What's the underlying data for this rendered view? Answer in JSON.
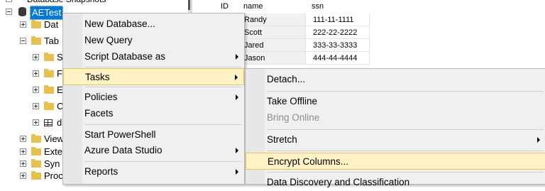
{
  "tree": {
    "top_partial_label": "Database Snapshots",
    "selected_db": "AETest",
    "rows": [
      {
        "label": "Dat"
      },
      {
        "label": "Tab"
      },
      {
        "label": "S"
      },
      {
        "label": "F"
      },
      {
        "label": "E"
      },
      {
        "label": "C"
      },
      {
        "label": "d"
      },
      {
        "label": "View"
      },
      {
        "label": "Exte"
      },
      {
        "label": "Syn"
      },
      {
        "label": "Proc"
      }
    ]
  },
  "grid": {
    "headers": [
      "ID",
      "name",
      "ssn"
    ],
    "rows": [
      [
        "",
        "Randy",
        "111-11-1111"
      ],
      [
        "",
        "Scott",
        "222-22-2222"
      ],
      [
        "",
        "Jared",
        "333-33-3333"
      ],
      [
        "",
        "Jason",
        "444-44-4444"
      ]
    ]
  },
  "context_menu": {
    "items": [
      {
        "label": "New Database..."
      },
      {
        "label": "New Query"
      },
      {
        "label": "Script Database as"
      },
      {
        "label": "Tasks"
      },
      {
        "label": "Policies"
      },
      {
        "label": "Facets"
      },
      {
        "label": "Start PowerShell"
      },
      {
        "label": "Azure Data Studio"
      },
      {
        "label": "Reports"
      }
    ]
  },
  "tasks_submenu": {
    "items": [
      {
        "label": "Detach..."
      },
      {
        "label": "Take Offline"
      },
      {
        "label": "Bring Online"
      },
      {
        "label": "Stretch"
      },
      {
        "label": "Encrypt Columns..."
      },
      {
        "label": "Data Discovery and Classification"
      }
    ]
  },
  "colors": {
    "selection": "#0078d7",
    "menu_highlight": "#fff3c6",
    "folder": "#e8c04e"
  }
}
